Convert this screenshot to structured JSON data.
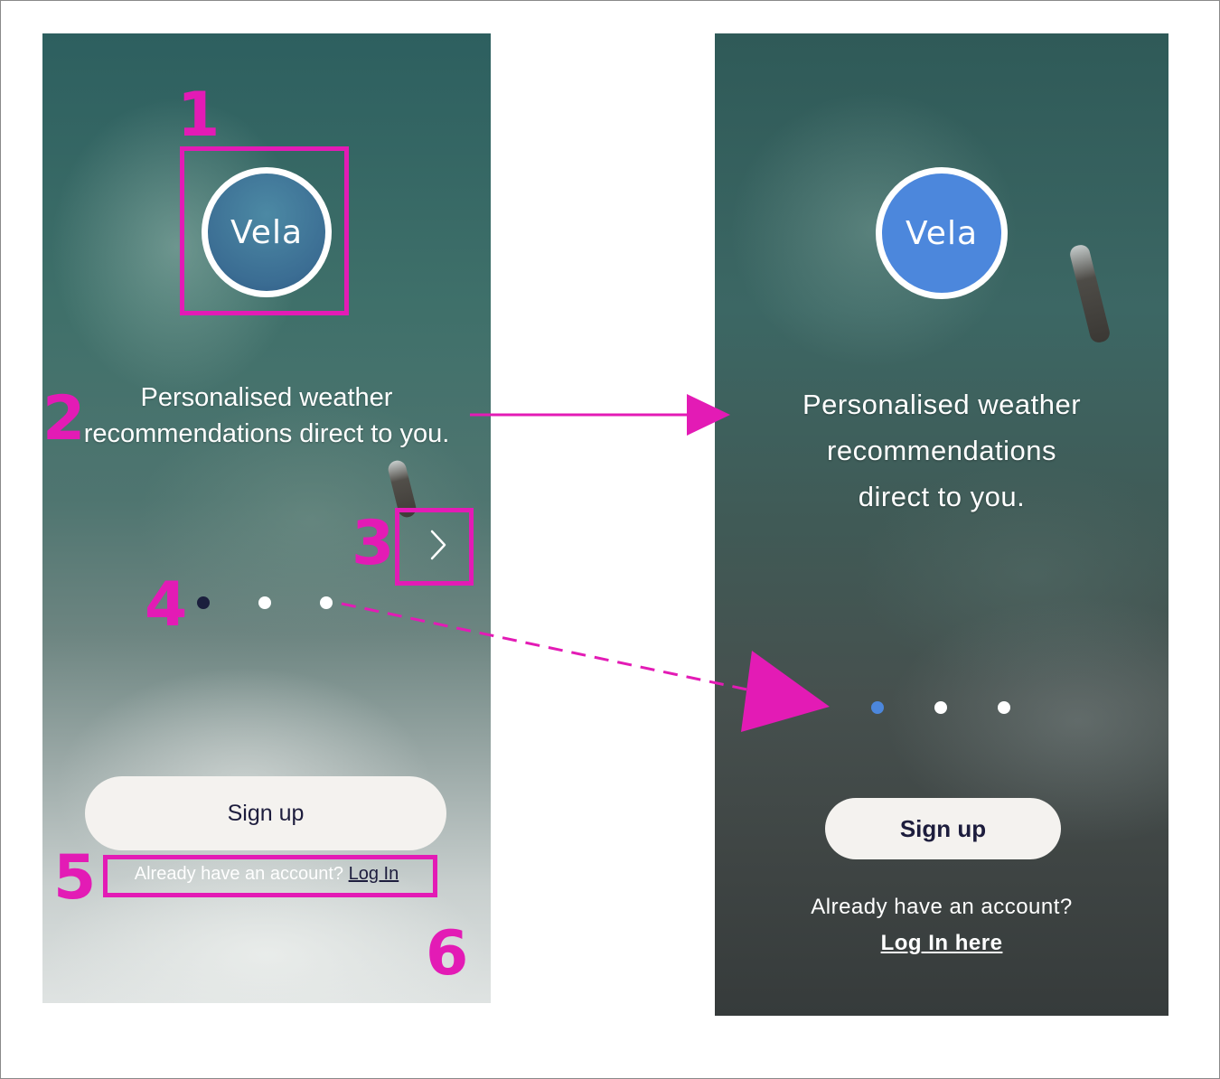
{
  "colors": {
    "annotation": "#e31bb5",
    "old_logo_fill": "#3b6d93",
    "new_logo_fill": "#4c87dc",
    "old_active_dot": "#1b1f3d",
    "new_active_dot": "#4c87dc",
    "button_bg": "#f4f2ef",
    "button_text": "#1d1d3d"
  },
  "old_screen": {
    "logo_text": "Vela",
    "tagline": "Personalised weather recommendations direct to you.",
    "next_icon": "chevron-right-icon",
    "pagination": {
      "count": 3,
      "active_index": 0
    },
    "signup_label": "Sign up",
    "login_prompt": "Already have an account?",
    "login_link": "Log In"
  },
  "new_screen": {
    "logo_text": "Vela",
    "tagline_lines": [
      "Personalised weather",
      "recommendations",
      "direct to you."
    ],
    "pagination": {
      "count": 3,
      "active_index": 0
    },
    "signup_label": "Sign up",
    "login_prompt": "Already have an account?",
    "login_link": "Log In here"
  },
  "annotations": {
    "n1": "1",
    "n2": "2",
    "n3": "3",
    "n4": "4",
    "n5": "5",
    "n6": "6"
  }
}
